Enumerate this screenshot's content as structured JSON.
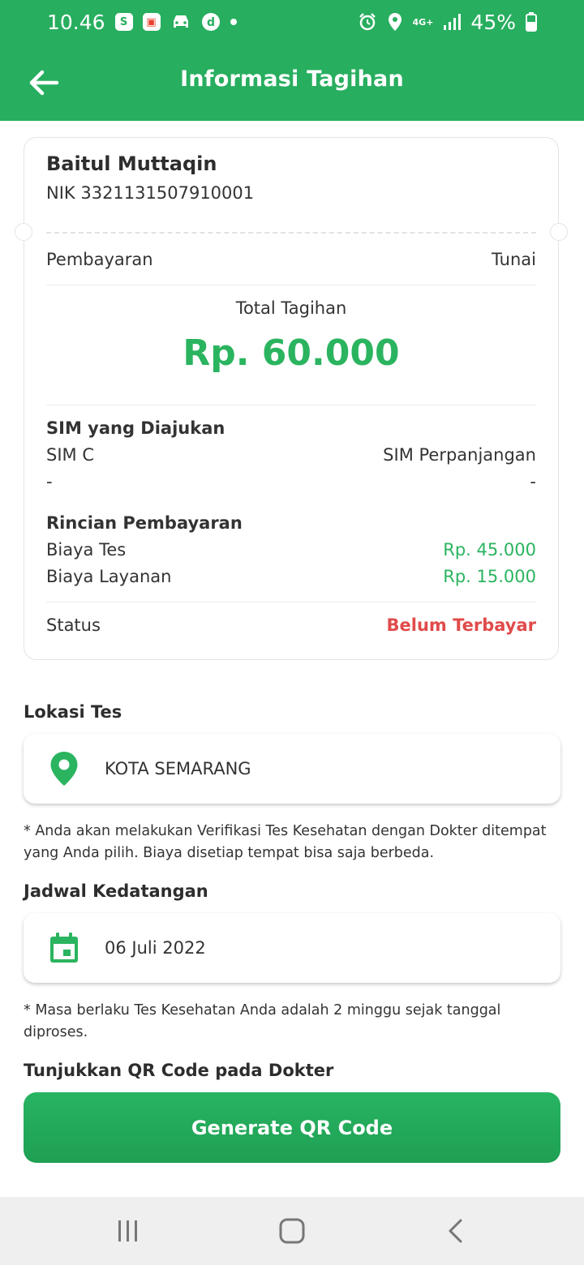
{
  "status_bar": {
    "time": "10.46",
    "network": "4G+",
    "battery": "45%",
    "icons": [
      "shopee-icon",
      "app-icon",
      "car-icon",
      "d-icon",
      "dot-icon",
      "alarm-icon",
      "location-icon",
      "signal-icon",
      "battery-icon"
    ]
  },
  "header": {
    "title": "Informasi Tagihan",
    "back_icon": "arrow-left-icon"
  },
  "bill": {
    "name": "Baitul Muttaqin",
    "nik": "NIK 3321131507910001",
    "payment_label": "Pembayaran",
    "payment_value": "Tunai",
    "total_label": "Total Tagihan",
    "total_value": "Rp. 60.000",
    "sim_title": "SIM yang Diajukan",
    "sim_type": "SIM C",
    "sim_kind": "SIM Perpanjangan",
    "sim_sub_left": "-",
    "sim_sub_right": "-",
    "detail_title": "Rincian Pembayaran",
    "items": [
      {
        "label": "Biaya Tes",
        "value": "Rp. 45.000"
      },
      {
        "label": "Biaya Layanan",
        "value": "Rp. 15.000"
      }
    ],
    "status_label": "Status",
    "status_value": "Belum Terbayar"
  },
  "location": {
    "label": "Lokasi Tes",
    "value": "KOTA SEMARANG",
    "note": "* Anda akan melakukan Verifikasi Tes Kesehatan dengan Dokter ditempat yang Anda pilih. Biaya disetiap tempat bisa saja berbeda."
  },
  "schedule": {
    "label": "Jadwal Kedatangan",
    "value": "06 Juli 2022",
    "note": "* Masa berlaku Tes Kesehatan Anda adalah 2 minggu sejak tanggal diproses."
  },
  "qr": {
    "label": "Tunjukkan QR Code pada Dokter",
    "button": "Generate QR Code"
  },
  "colors": {
    "primary": "#27ae5f",
    "amount_green": "#2bb45f",
    "status_red": "#e14b4b"
  }
}
